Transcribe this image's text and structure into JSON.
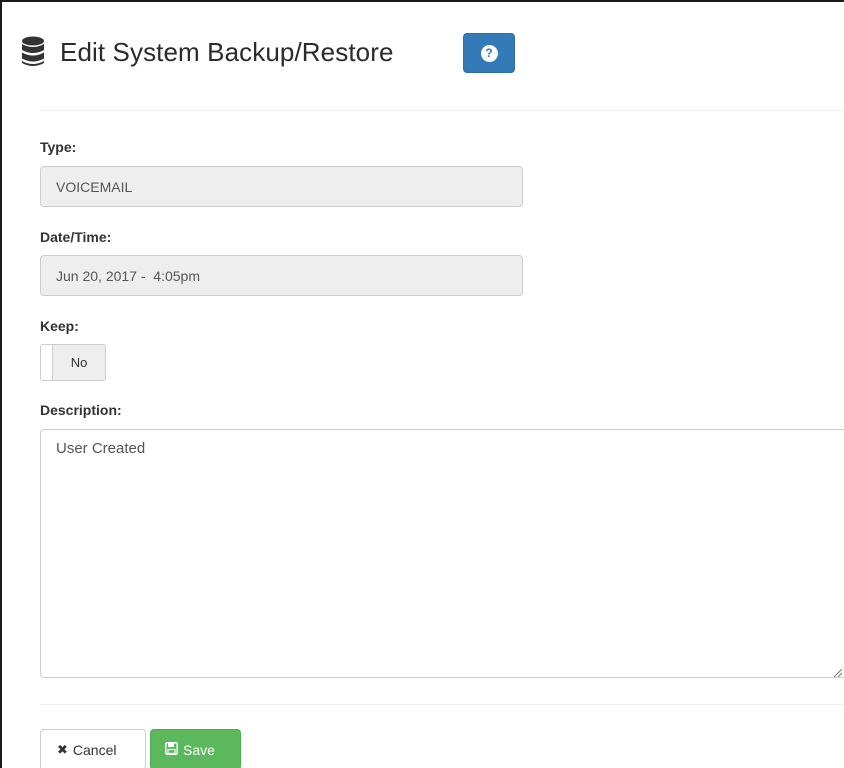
{
  "header": {
    "icon": "database-icon",
    "title": "Edit System Backup/Restore",
    "help_icon": "question-circle-icon",
    "help_glyph": "?"
  },
  "form": {
    "type": {
      "label": "Type:",
      "value": "VOICEMAIL"
    },
    "datetime": {
      "label": "Date/Time:",
      "value": "Jun 20, 2017 -  4:05pm"
    },
    "keep": {
      "label": "Keep:",
      "value": "No"
    },
    "description": {
      "label": "Description:",
      "value": "User Created"
    }
  },
  "actions": {
    "cancel": {
      "icon": "close-icon",
      "glyph": "✖",
      "label": "Cancel"
    },
    "save": {
      "icon": "floppy-disk-icon",
      "label": "Save"
    }
  },
  "colors": {
    "primary": "#337ab7",
    "success": "#5cb85c",
    "readonly_bg": "#eeeeee",
    "border": "#cccccc"
  }
}
